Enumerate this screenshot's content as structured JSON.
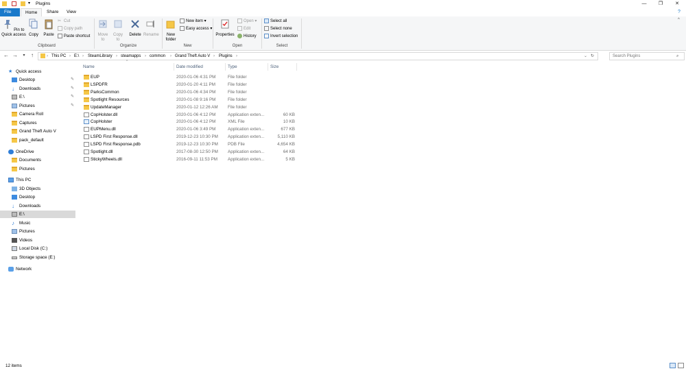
{
  "window": {
    "title": "Plugins",
    "controls": {
      "minimize": "—",
      "maximize": "❐",
      "close": "✕"
    }
  },
  "tabs": [
    {
      "label": "File"
    },
    {
      "label": "Home"
    },
    {
      "label": "Share"
    },
    {
      "label": "View"
    }
  ],
  "ribbon": {
    "clipboard": {
      "label": "Clipboard",
      "pin_to_quick_access": "Pin to Quick access",
      "copy": "Copy",
      "paste": "Paste",
      "cut": "Cut",
      "copy_path": "Copy path",
      "paste_shortcut": "Paste shortcut"
    },
    "organize": {
      "label": "Organize",
      "move_to": "Move to",
      "copy_to": "Copy to",
      "delete": "Delete",
      "rename": "Rename"
    },
    "new": {
      "label": "New",
      "new_folder": "New folder",
      "new_item": "New item",
      "easy_access": "Easy access"
    },
    "open": {
      "label": "Open",
      "properties": "Properties",
      "open": "Open",
      "edit": "Edit",
      "history": "History"
    },
    "select": {
      "label": "Select",
      "select_all": "Select all",
      "select_none": "Select none",
      "invert_selection": "Invert selection"
    }
  },
  "address": {
    "crumbs": [
      "This PC",
      "E:\\",
      "SteamLibrary",
      "steamapps",
      "common",
      "Grand Theft Auto V",
      "Plugins"
    ],
    "search_placeholder": "Search Plugins"
  },
  "nav": {
    "quick_access": "Quick access",
    "items_quick": [
      "Desktop",
      "Downloads",
      "E:\\",
      "Pictures",
      "Camera Roll",
      "Captures",
      "Grand Theft Auto V",
      "pack_default"
    ],
    "onedrive": "OneDrive",
    "items_onedrive": [
      "Documents",
      "Pictures"
    ],
    "this_pc": "This PC",
    "items_pc": [
      "3D Objects",
      "Desktop",
      "Downloads",
      "E:\\",
      "Music",
      "Pictures",
      "Videos",
      "Local Disk (C:)",
      "Storage space (E:)"
    ],
    "network": "Network"
  },
  "columns": {
    "name": "Name",
    "date": "Date modified",
    "type": "Type",
    "size": "Size"
  },
  "files": [
    {
      "name": "EUP",
      "date": "2020-01-06 4:31 PM",
      "type": "File folder",
      "size": "",
      "kind": "folder"
    },
    {
      "name": "LSPDFR",
      "date": "2020-01-20 4:11 PM",
      "type": "File folder",
      "size": "",
      "kind": "folder"
    },
    {
      "name": "ParksCommon",
      "date": "2020-01-06 4:34 PM",
      "type": "File folder",
      "size": "",
      "kind": "folder"
    },
    {
      "name": "Spotlight Resources",
      "date": "2020-01-08 9:16 PM",
      "type": "File folder",
      "size": "",
      "kind": "folder"
    },
    {
      "name": "UpdateManager",
      "date": "2020-01-12 12:26 AM",
      "type": "File folder",
      "size": "",
      "kind": "folder"
    },
    {
      "name": "CopHolster.dll",
      "date": "2020-01-06 4:12 PM",
      "type": "Application exten...",
      "size": "60 KB",
      "kind": "dll"
    },
    {
      "name": "CopHolster",
      "date": "2020-01-06 4:12 PM",
      "type": "XML File",
      "size": "10 KB",
      "kind": "xml"
    },
    {
      "name": "EUPMenu.dll",
      "date": "2020-01-06 3:49 PM",
      "type": "Application exten...",
      "size": "677 KB",
      "kind": "dll"
    },
    {
      "name": "LSPD First Response.dll",
      "date": "2019-12-23 10:30 PM",
      "type": "Application exten...",
      "size": "5,110 KB",
      "kind": "dll"
    },
    {
      "name": "LSPD First Response.pdb",
      "date": "2019-12-23 10:30 PM",
      "type": "PDB File",
      "size": "4,654 KB",
      "kind": "doc"
    },
    {
      "name": "Spotlight.dll",
      "date": "2017-08-30 12:50 PM",
      "type": "Application exten...",
      "size": "64 KB",
      "kind": "dll"
    },
    {
      "name": "StickyWheels.dll",
      "date": "2016-09-11 11:53 PM",
      "type": "Application exten...",
      "size": "5 KB",
      "kind": "dll"
    }
  ],
  "status": {
    "item_count": "12 items"
  }
}
